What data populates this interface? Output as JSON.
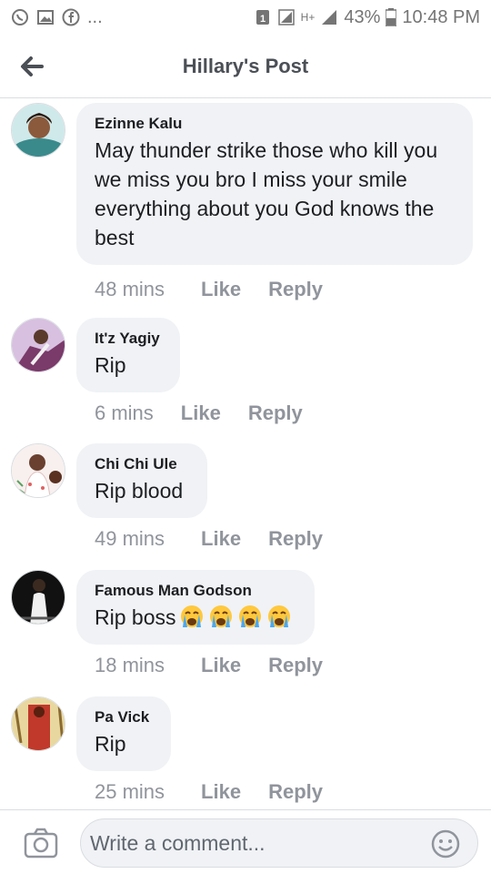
{
  "status_bar": {
    "battery": "43%",
    "time": "10:48 PM",
    "sim_badge": "1",
    "network": "H+",
    "icons": [
      "whatsapp-icon",
      "gallery-icon",
      "facebook-icon",
      "more-dots-icon"
    ]
  },
  "header": {
    "title": "Hillary's Post",
    "back_icon": "arrow-left-icon"
  },
  "comments": [
    {
      "author": "Ezinne Kalu",
      "text": "May thunder strike those who kill you we miss you bro I miss your smile everything about you God knows the best",
      "time": "48 mins",
      "like": "Like",
      "reply": "Reply",
      "avatar_color": "#3a8a8c"
    },
    {
      "author": "It'z Yagiy",
      "text": "Rip",
      "time": "6 mins",
      "like": "Like",
      "reply": "Reply",
      "avatar_color": "#7a3a6a"
    },
    {
      "author": "Chi Chi Ule",
      "text": "Rip blood",
      "time": "49 mins",
      "like": "Like",
      "reply": "Reply",
      "avatar_color": "#d99a9a"
    },
    {
      "author": "Famous Man Godson",
      "text": "Rip boss",
      "emojis": [
        "crying-face-icon",
        "crying-face-icon",
        "crying-face-icon",
        "crying-face-icon"
      ],
      "time": "18 mins",
      "like": "Like",
      "reply": "Reply",
      "avatar_color": "#202020"
    },
    {
      "author": "Pa Vick",
      "text": "Rip",
      "time": "25 mins",
      "like": "Like",
      "reply": "Reply",
      "avatar_color": "#c0392b"
    }
  ],
  "composer": {
    "placeholder": "Write a comment...",
    "camera_icon": "camera-icon",
    "emoji_icon": "smiley-icon"
  }
}
